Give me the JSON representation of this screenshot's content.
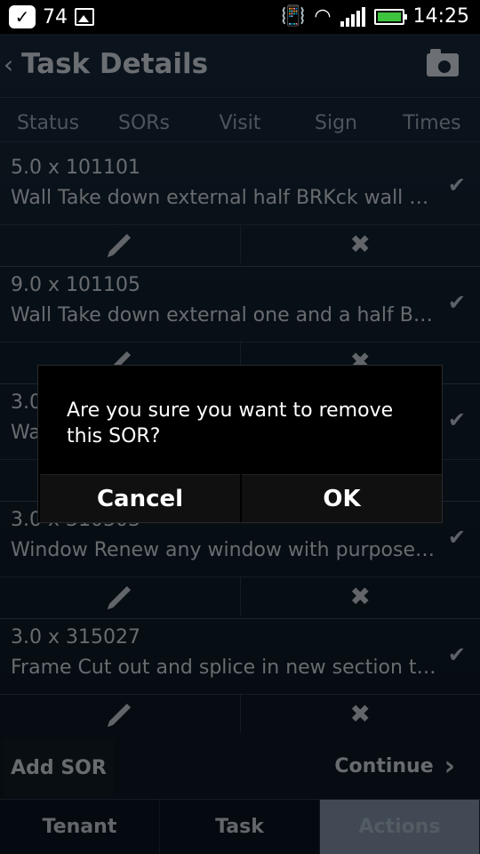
{
  "status_bar": {
    "notification_count": "74",
    "time": "14:25",
    "icons": [
      "check-badge-icon",
      "image-icon",
      "vibrate-icon",
      "wifi-icon",
      "signal-icon",
      "battery-icon"
    ]
  },
  "header": {
    "title": "Task Details",
    "back_icon": "back-chevron-icon",
    "camera_icon": "camera-icon"
  },
  "tabs": [
    "Status",
    "SORs",
    "Visit",
    "Sign",
    "Times"
  ],
  "sor_items": [
    {
      "qty_code": "5.0 x 101101",
      "description": "Wall Take down external half BRKck wall an…"
    },
    {
      "qty_code": "9.0 x 101105",
      "description": "Wall Take down external one and a half BR…"
    },
    {
      "qty_code": "3.0",
      "description": "Wa"
    },
    {
      "qty_code": "3.0 x 310303",
      "description": "Window Renew any window with purpose …"
    },
    {
      "qty_code": "3.0 x 315027",
      "description": "Frame Cut out and splice in new section tre…"
    }
  ],
  "footer": {
    "add_sor": "Add SOR",
    "continue": "Continue"
  },
  "bottom_nav": [
    "Tenant",
    "Task",
    "Actions"
  ],
  "dialog": {
    "message": "Are you sure you want to remove this SOR?",
    "cancel": "Cancel",
    "ok": "OK"
  },
  "colors": {
    "background_top": "#17283a",
    "background_bottom": "#0b1722",
    "active_nav": "#8295a8",
    "battery_green": "#3ec33e",
    "dialog_bg": "#000000"
  }
}
